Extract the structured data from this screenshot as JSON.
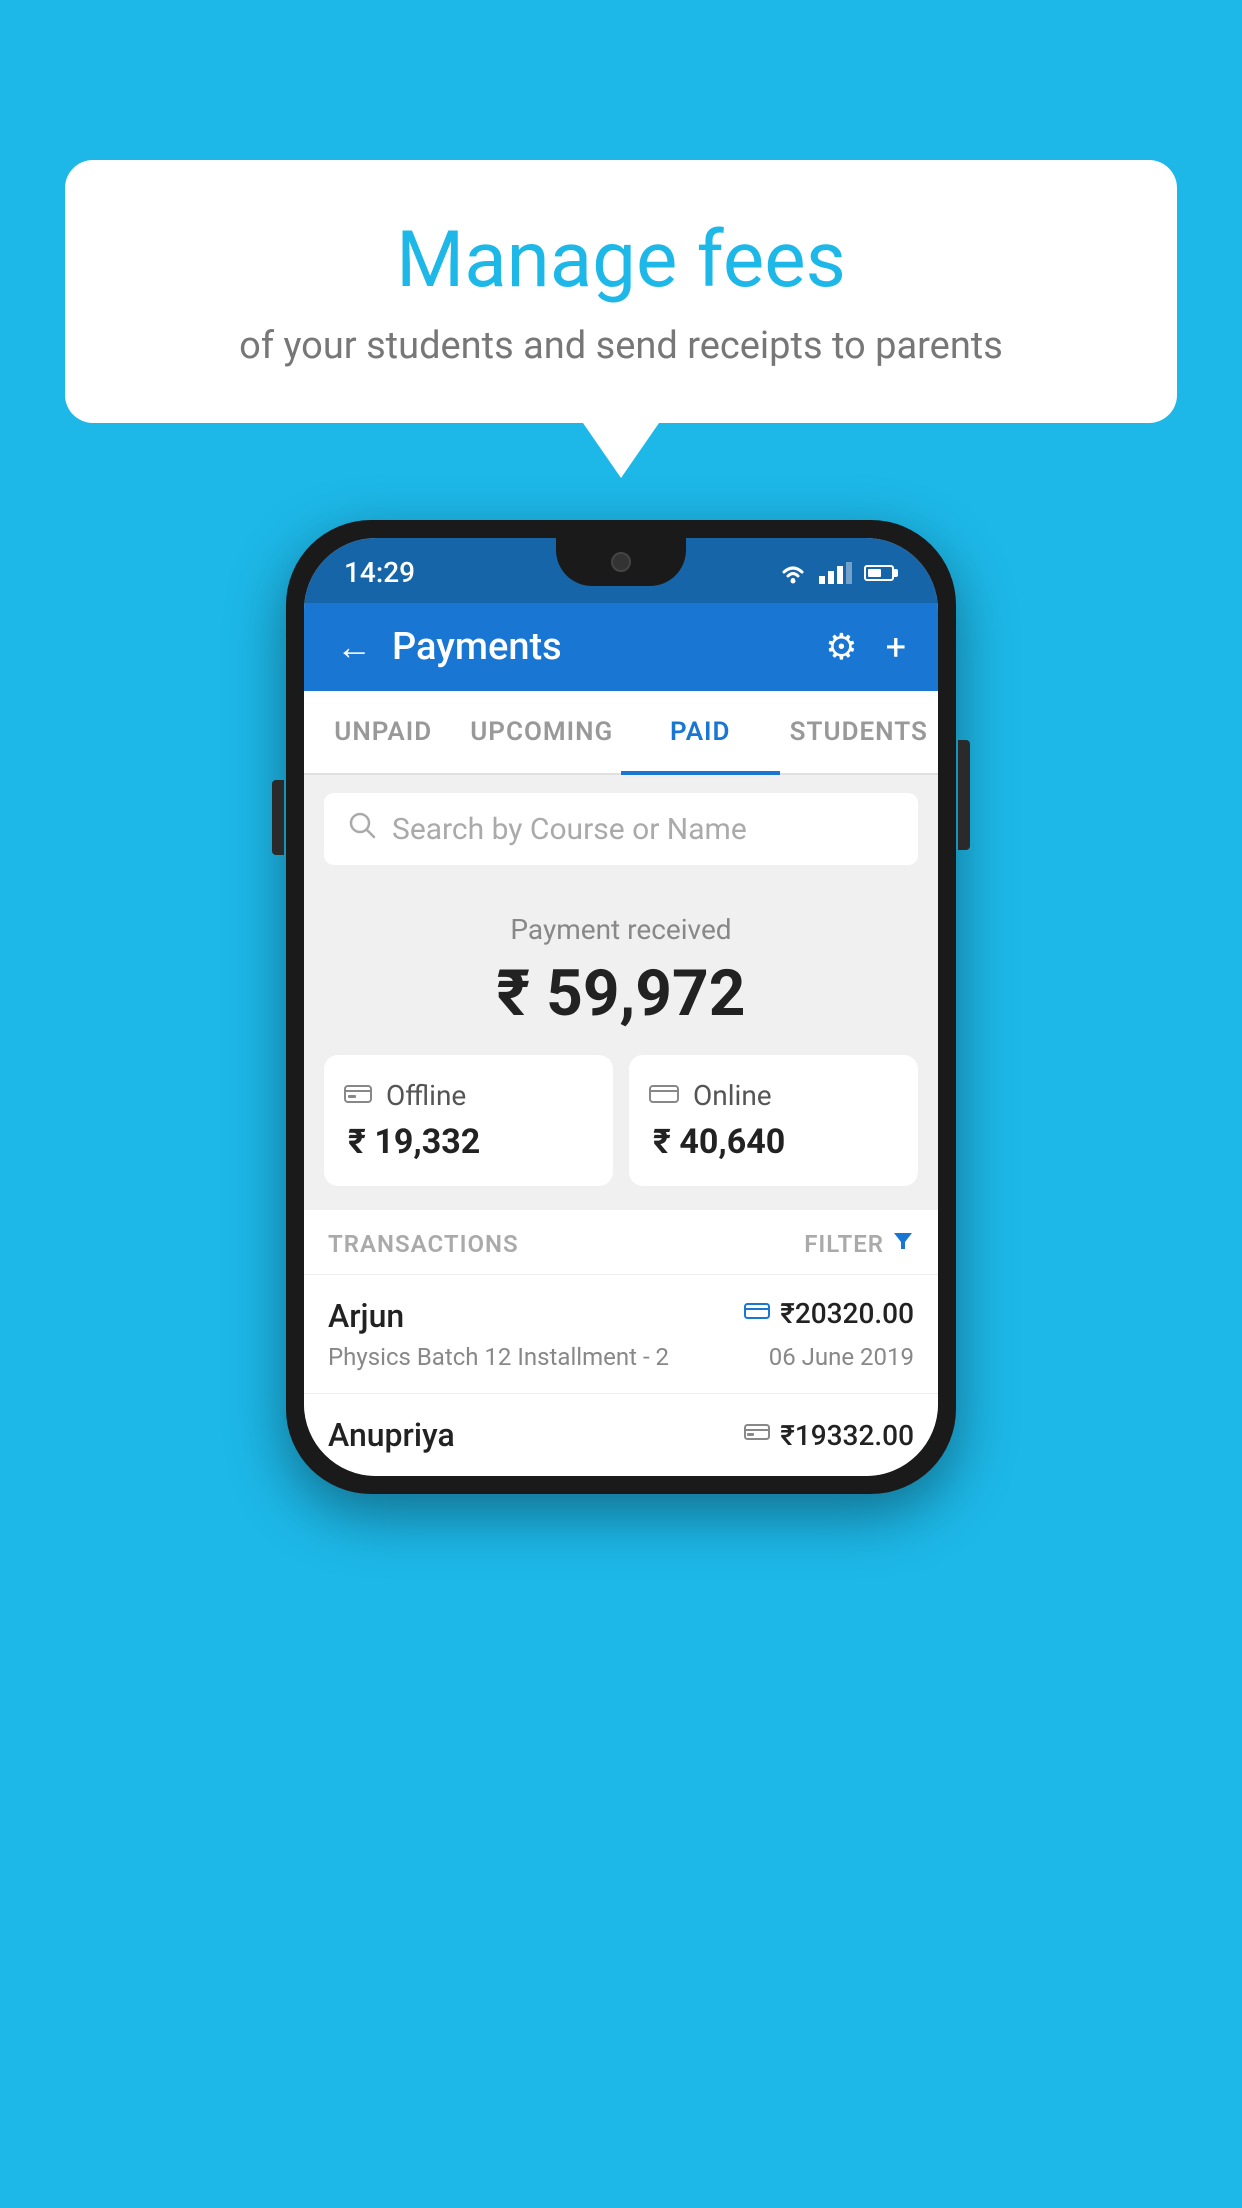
{
  "background_color": "#1db8e8",
  "speech_bubble": {
    "title": "Manage fees",
    "subtitle": "of your students and send receipts to parents"
  },
  "status_bar": {
    "time": "14:29",
    "wifi": true,
    "signal": true,
    "battery": true
  },
  "app_bar": {
    "title": "Payments",
    "back_label": "←",
    "settings_label": "⚙",
    "add_label": "+"
  },
  "tabs": [
    {
      "label": "UNPAID",
      "active": false
    },
    {
      "label": "UPCOMING",
      "active": false
    },
    {
      "label": "PAID",
      "active": true
    },
    {
      "label": "STUDENTS",
      "active": false
    }
  ],
  "search": {
    "placeholder": "Search by Course or Name"
  },
  "payment_received": {
    "label": "Payment received",
    "amount": "₹ 59,972"
  },
  "payment_breakdown": {
    "offline": {
      "type": "Offline",
      "amount": "₹ 19,332"
    },
    "online": {
      "type": "Online",
      "amount": "₹ 40,640"
    }
  },
  "transactions_section": {
    "label": "TRANSACTIONS",
    "filter_label": "FILTER"
  },
  "transactions": [
    {
      "name": "Arjun",
      "course": "Physics Batch 12 Installment - 2",
      "amount": "₹20320.00",
      "date": "06 June 2019",
      "payment_method": "online"
    },
    {
      "name": "Anupriya",
      "course": "",
      "amount": "₹19332.00",
      "date": "",
      "payment_method": "offline"
    }
  ]
}
